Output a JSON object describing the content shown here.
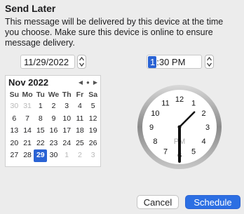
{
  "dialog": {
    "title": "Send Later",
    "description": "This message will be delivered by this device at the time you choose. Make sure this device is online to ensure message delivery."
  },
  "date": {
    "value": "11/29/2022"
  },
  "time": {
    "hour": "1",
    "rest": ":30 PM"
  },
  "calendar": {
    "month_label": "Nov 2022",
    "nav": {
      "prev": "◀",
      "today": "●",
      "next": "▶"
    },
    "weekdays": [
      "Su",
      "Mo",
      "Tu",
      "We",
      "Th",
      "Fr",
      "Sa"
    ],
    "days": [
      {
        "d": "30",
        "other": true
      },
      {
        "d": "31",
        "other": true
      },
      {
        "d": "1"
      },
      {
        "d": "2"
      },
      {
        "d": "3"
      },
      {
        "d": "4"
      },
      {
        "d": "5"
      },
      {
        "d": "6"
      },
      {
        "d": "7"
      },
      {
        "d": "8"
      },
      {
        "d": "9"
      },
      {
        "d": "10"
      },
      {
        "d": "11"
      },
      {
        "d": "12"
      },
      {
        "d": "13"
      },
      {
        "d": "14"
      },
      {
        "d": "15"
      },
      {
        "d": "16"
      },
      {
        "d": "17"
      },
      {
        "d": "18"
      },
      {
        "d": "19"
      },
      {
        "d": "20"
      },
      {
        "d": "21"
      },
      {
        "d": "22"
      },
      {
        "d": "23"
      },
      {
        "d": "24"
      },
      {
        "d": "25"
      },
      {
        "d": "26"
      },
      {
        "d": "27"
      },
      {
        "d": "28"
      },
      {
        "d": "29",
        "selected": true
      },
      {
        "d": "30"
      },
      {
        "d": "1",
        "other": true
      },
      {
        "d": "2",
        "other": true
      },
      {
        "d": "3",
        "other": true
      }
    ]
  },
  "clock": {
    "hour": 1,
    "minute": 30,
    "period": "PM",
    "numerals": [
      "12",
      "1",
      "2",
      "3",
      "4",
      "5",
      "6",
      "7",
      "8",
      "9",
      "10",
      "11"
    ]
  },
  "buttons": {
    "cancel": "Cancel",
    "schedule": "Schedule"
  },
  "colors": {
    "accent": "#2c6fe3",
    "selection": "#2a63d4"
  }
}
